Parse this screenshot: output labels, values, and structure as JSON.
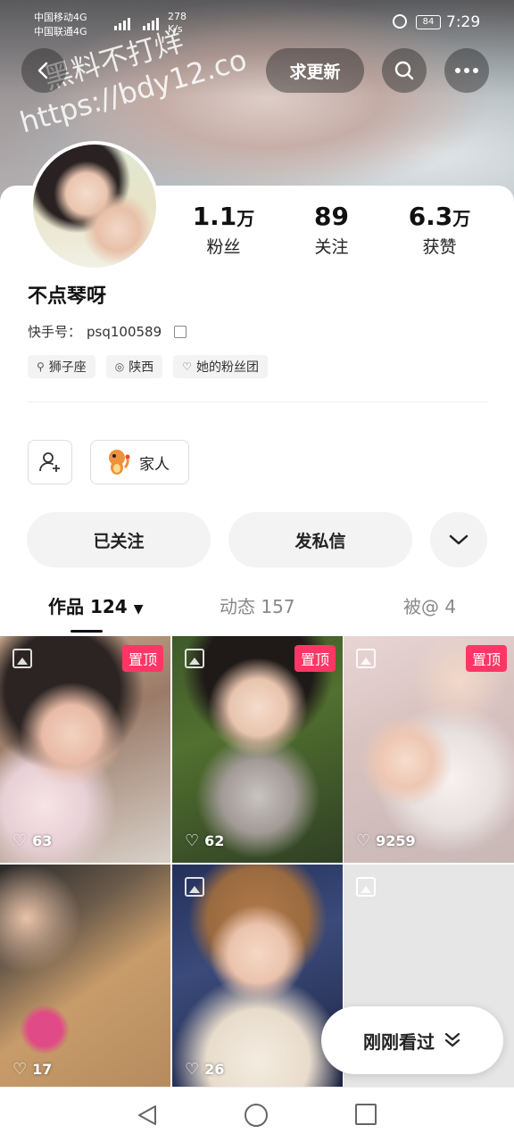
{
  "status_bar": {
    "carrier1": "中国移动4G",
    "carrier2": "中国联通4G",
    "net1": "4G",
    "net2": "4G",
    "speed_value": "278",
    "speed_unit": "K/s",
    "battery": "84",
    "time": "7:29"
  },
  "header": {
    "update_label": "求更新",
    "watermark_line1": "黑料不打烊",
    "watermark_line2": "https://bdy12.co"
  },
  "profile": {
    "name": "不点琴呀",
    "uid_label": "快手号：",
    "uid": "psq100589",
    "stats": [
      {
        "num": "1.1",
        "unit": "万",
        "label": "粉丝"
      },
      {
        "num": "89",
        "unit": "",
        "label": "关注"
      },
      {
        "num": "6.3",
        "unit": "万",
        "label": "获赞"
      }
    ],
    "tags": [
      {
        "icon": "search-icon",
        "label": "狮子座"
      },
      {
        "icon": "location-icon",
        "label": "陕西"
      },
      {
        "icon": "fan-club-icon",
        "label": "她的粉丝团"
      }
    ],
    "group_label": "家人"
  },
  "actions": {
    "follow_label": "已关注",
    "message_label": "发私信"
  },
  "tabs": [
    {
      "label": "作品 124",
      "active": true
    },
    {
      "label": "动态 157",
      "active": false
    },
    {
      "label": "被@ 4",
      "active": false
    }
  ],
  "pin_label": "置顶",
  "grid": [
    {
      "likes": "63",
      "pinned": true
    },
    {
      "likes": "62",
      "pinned": true
    },
    {
      "likes": "9259",
      "pinned": true
    },
    {
      "likes": "17",
      "pinned": false
    },
    {
      "likes": "26",
      "pinned": false
    },
    {
      "likes": "",
      "pinned": false
    }
  ],
  "recent_label": "刚刚看过",
  "colors": {
    "pin_badge": "#fe3666",
    "button_bg": "#f3f3f3"
  }
}
